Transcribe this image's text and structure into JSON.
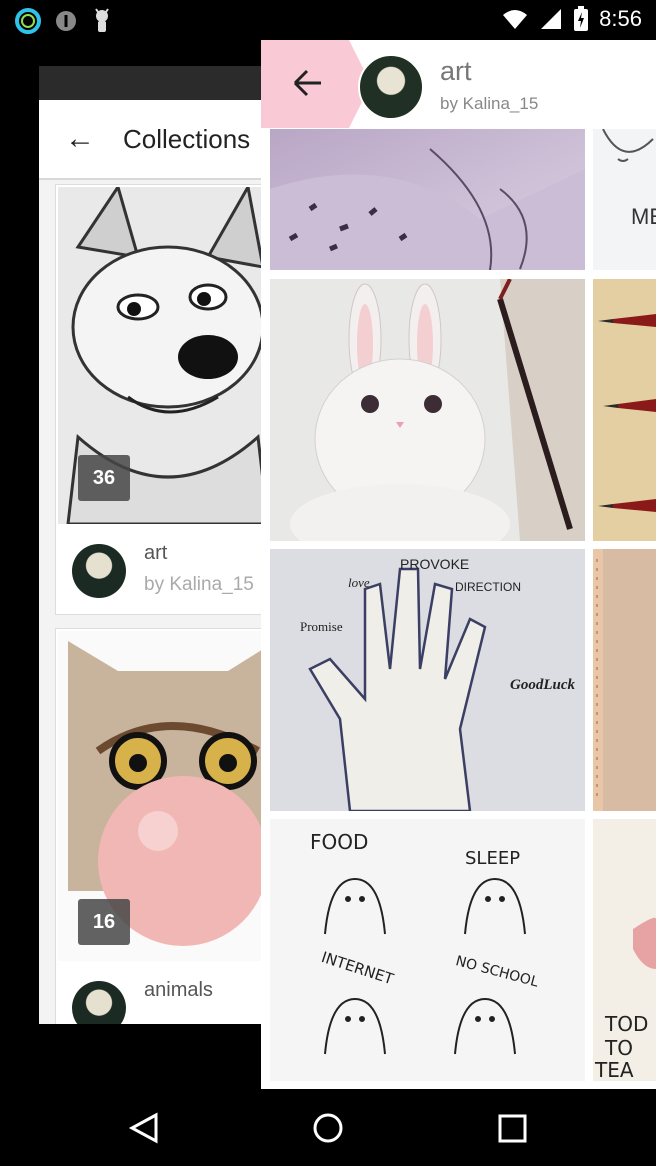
{
  "status_bar": {
    "time": "8:56"
  },
  "background_screen": {
    "title": "Collections",
    "collections": [
      {
        "count": "36",
        "name": "art",
        "owner": "by Kalina_15"
      },
      {
        "count": "16",
        "name": "animals"
      }
    ]
  },
  "panel": {
    "title": "art",
    "subtitle": "by Kalina_15",
    "tiles": [
      {
        "name": "wing-sketch"
      },
      {
        "name": "face-sketch",
        "text": "ME"
      },
      {
        "name": "bunny-drawing"
      },
      {
        "name": "pencils-photo"
      },
      {
        "name": "hand-drawing",
        "words": [
          "PROVOKE",
          "love",
          "DIRECTION",
          "Promise",
          "GoodLuck"
        ]
      },
      {
        "name": "beige-drawing"
      },
      {
        "name": "ghost-doodles",
        "words": [
          "FOOD",
          "SLEEP",
          "INTERNET",
          "NO SCHOOL"
        ]
      },
      {
        "name": "lips-drawing",
        "words": [
          "TOD",
          "TO",
          "TEA"
        ]
      }
    ]
  },
  "colors": {
    "accent_pink": "#f9c9d6",
    "panel_bg": "#ffffff",
    "dim_bg": "#000000"
  }
}
